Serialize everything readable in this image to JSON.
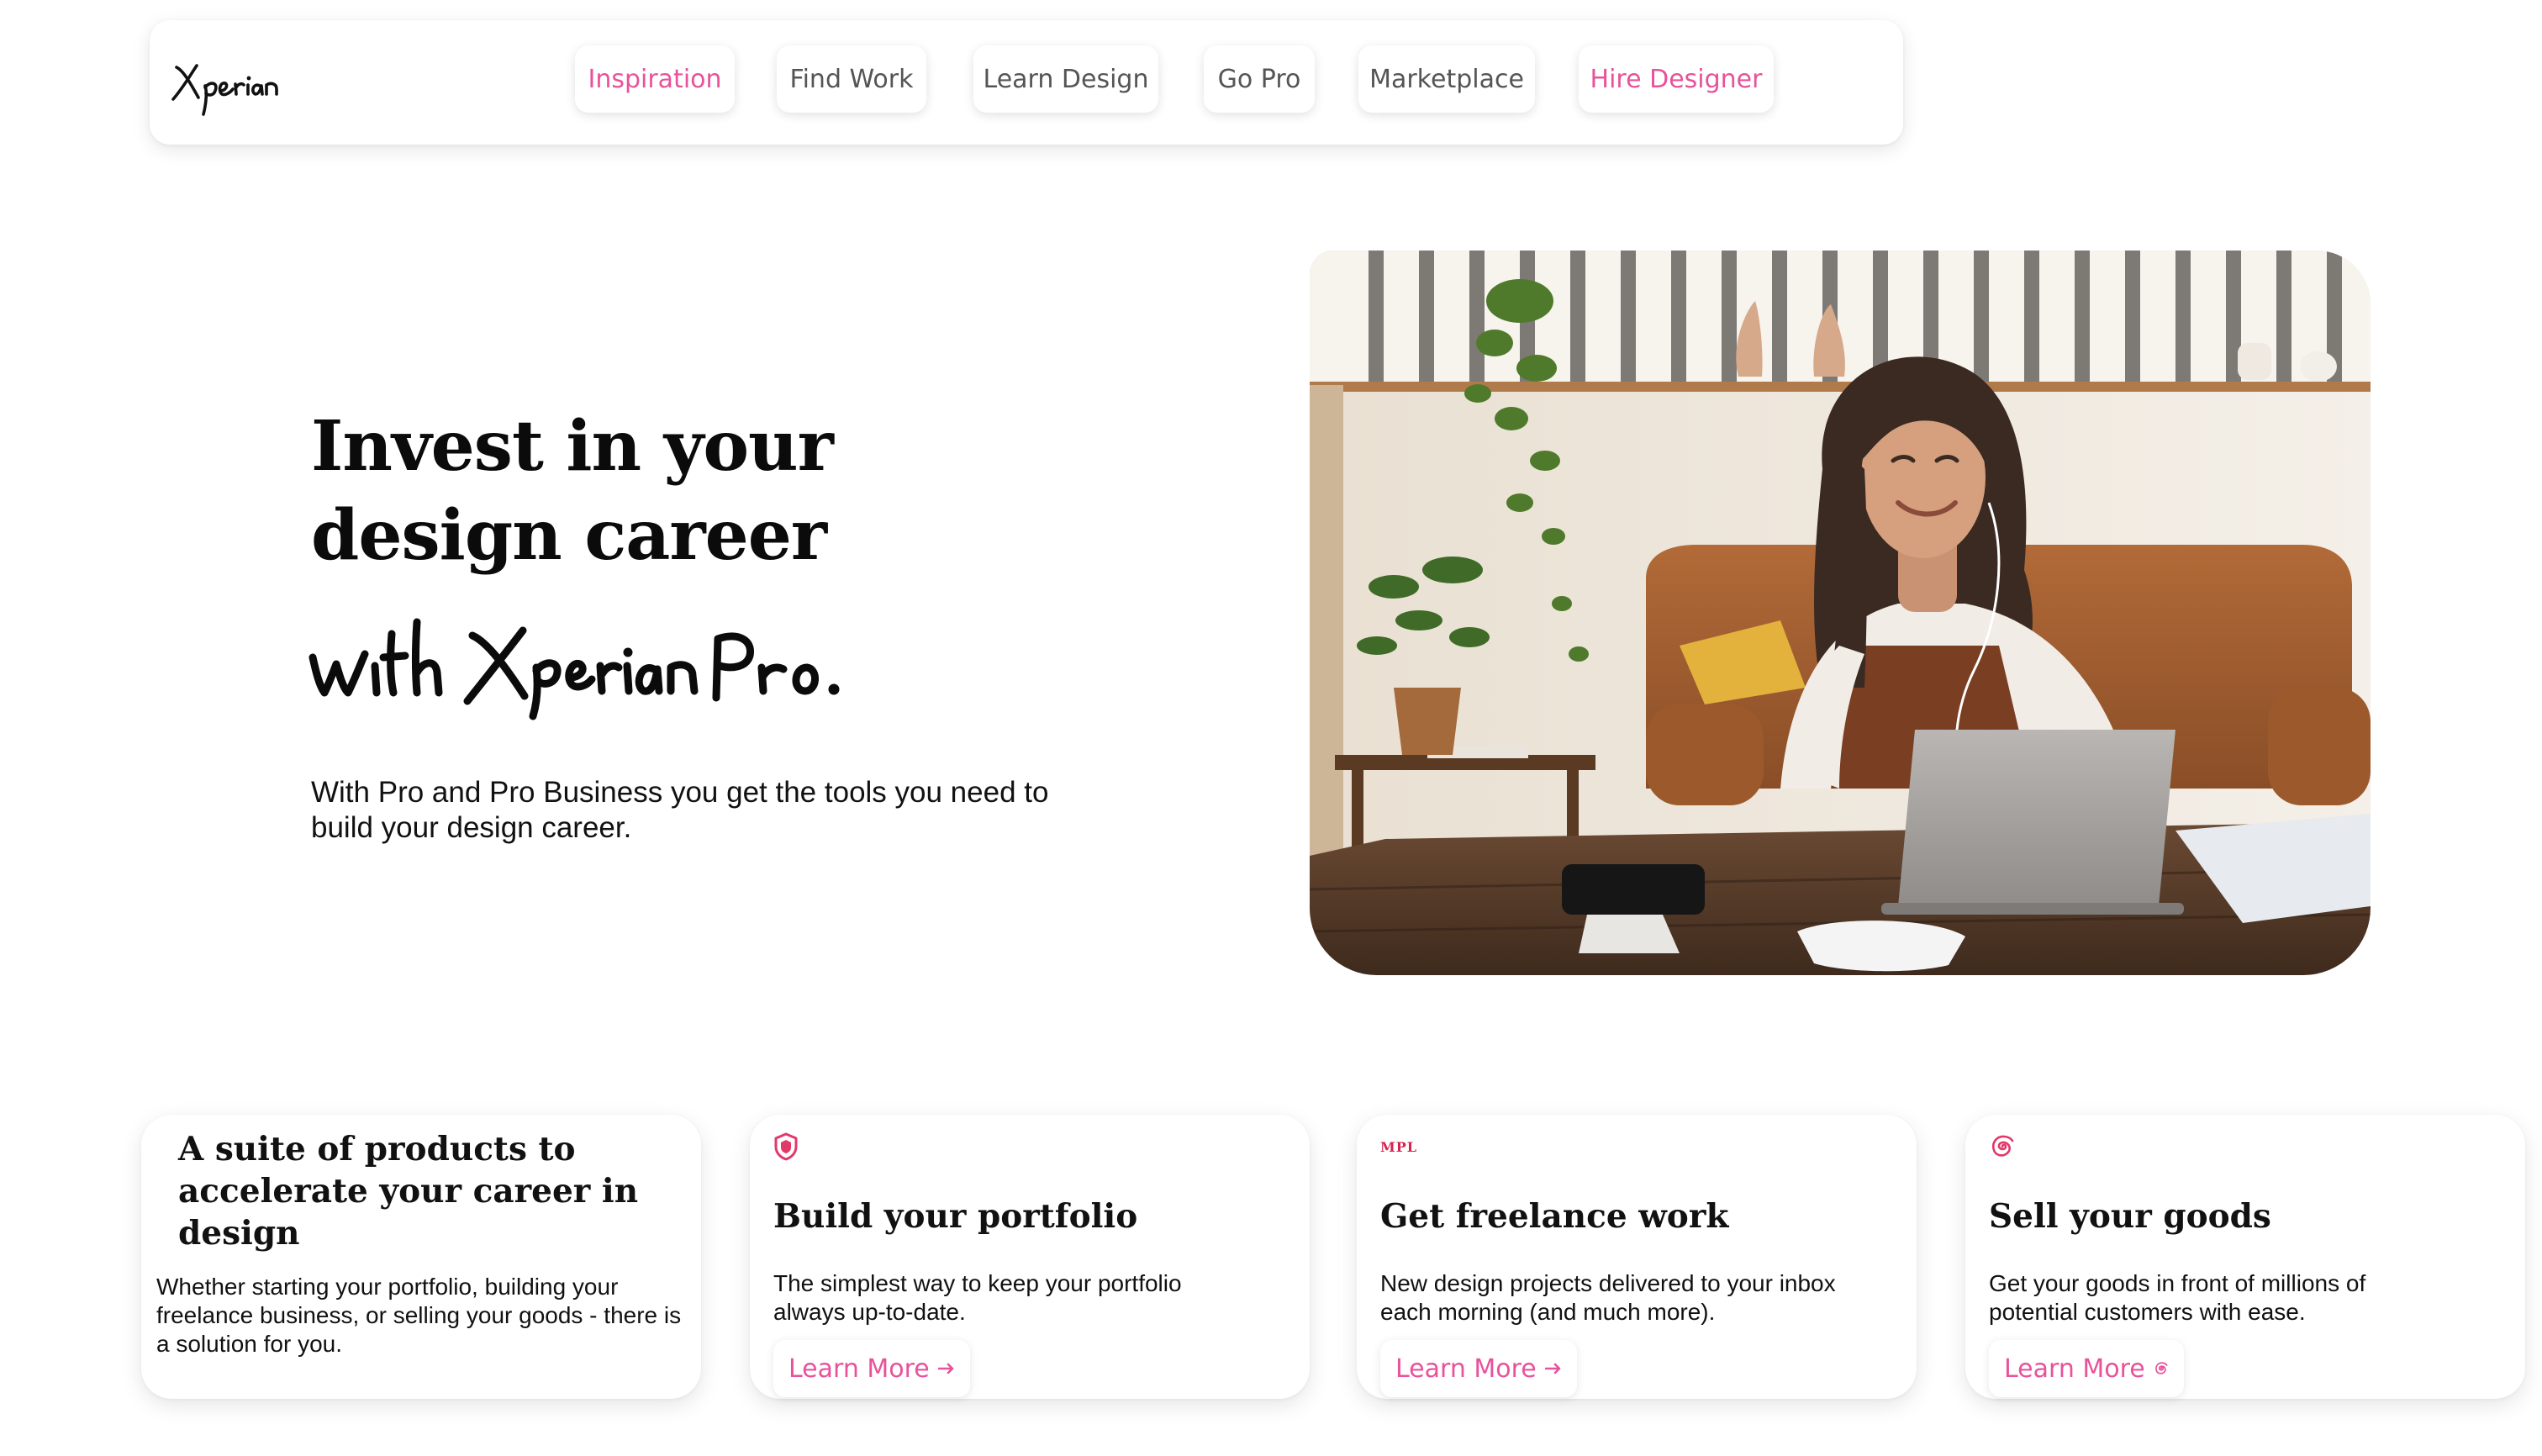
{
  "brand": {
    "logo_text": "Xperian",
    "accent_color": "#e8529b"
  },
  "nav": {
    "items": [
      {
        "label": "Inspiration",
        "accent": true
      },
      {
        "label": "Find Work",
        "accent": false
      },
      {
        "label": "Learn Design",
        "accent": false
      },
      {
        "label": "Go Pro",
        "accent": false
      },
      {
        "label": "Marketplace",
        "accent": false
      },
      {
        "label": "Hire Designer",
        "accent": true
      }
    ]
  },
  "hero": {
    "heading_line1": "Invest in your",
    "heading_line2": "design career",
    "script_line": "with Xperian Pro.",
    "subtitle": "With Pro and Pro Business you get the tools you need to build your design career.",
    "image_icon": "woman-working-on-laptop-photo"
  },
  "intro_card": {
    "title": "A suite of products to accelerate your career in design",
    "description": "Whether starting your portfolio, building your freelance business, or selling your goods - there is a solution for you."
  },
  "feature_cards": [
    {
      "icon": "shield-icon",
      "title": "Build your portfolio",
      "description": "The simplest way to keep your portfolio always up-to-date.",
      "link_label": "Learn More",
      "link_icon": "arrow-right-icon"
    },
    {
      "icon": "mpl-logo-icon",
      "icon_text": "MPL",
      "title": "Get freelance work",
      "description": "New design projects delivered to your inbox each morning (and much more).",
      "link_label": "Learn More",
      "link_icon": "arrow-right-icon"
    },
    {
      "icon": "spiral-icon",
      "title": "Sell your goods",
      "description": "Get your goods in front of millions of potential customers with ease.",
      "link_label": "Learn More",
      "link_icon": "spiral-icon"
    }
  ]
}
